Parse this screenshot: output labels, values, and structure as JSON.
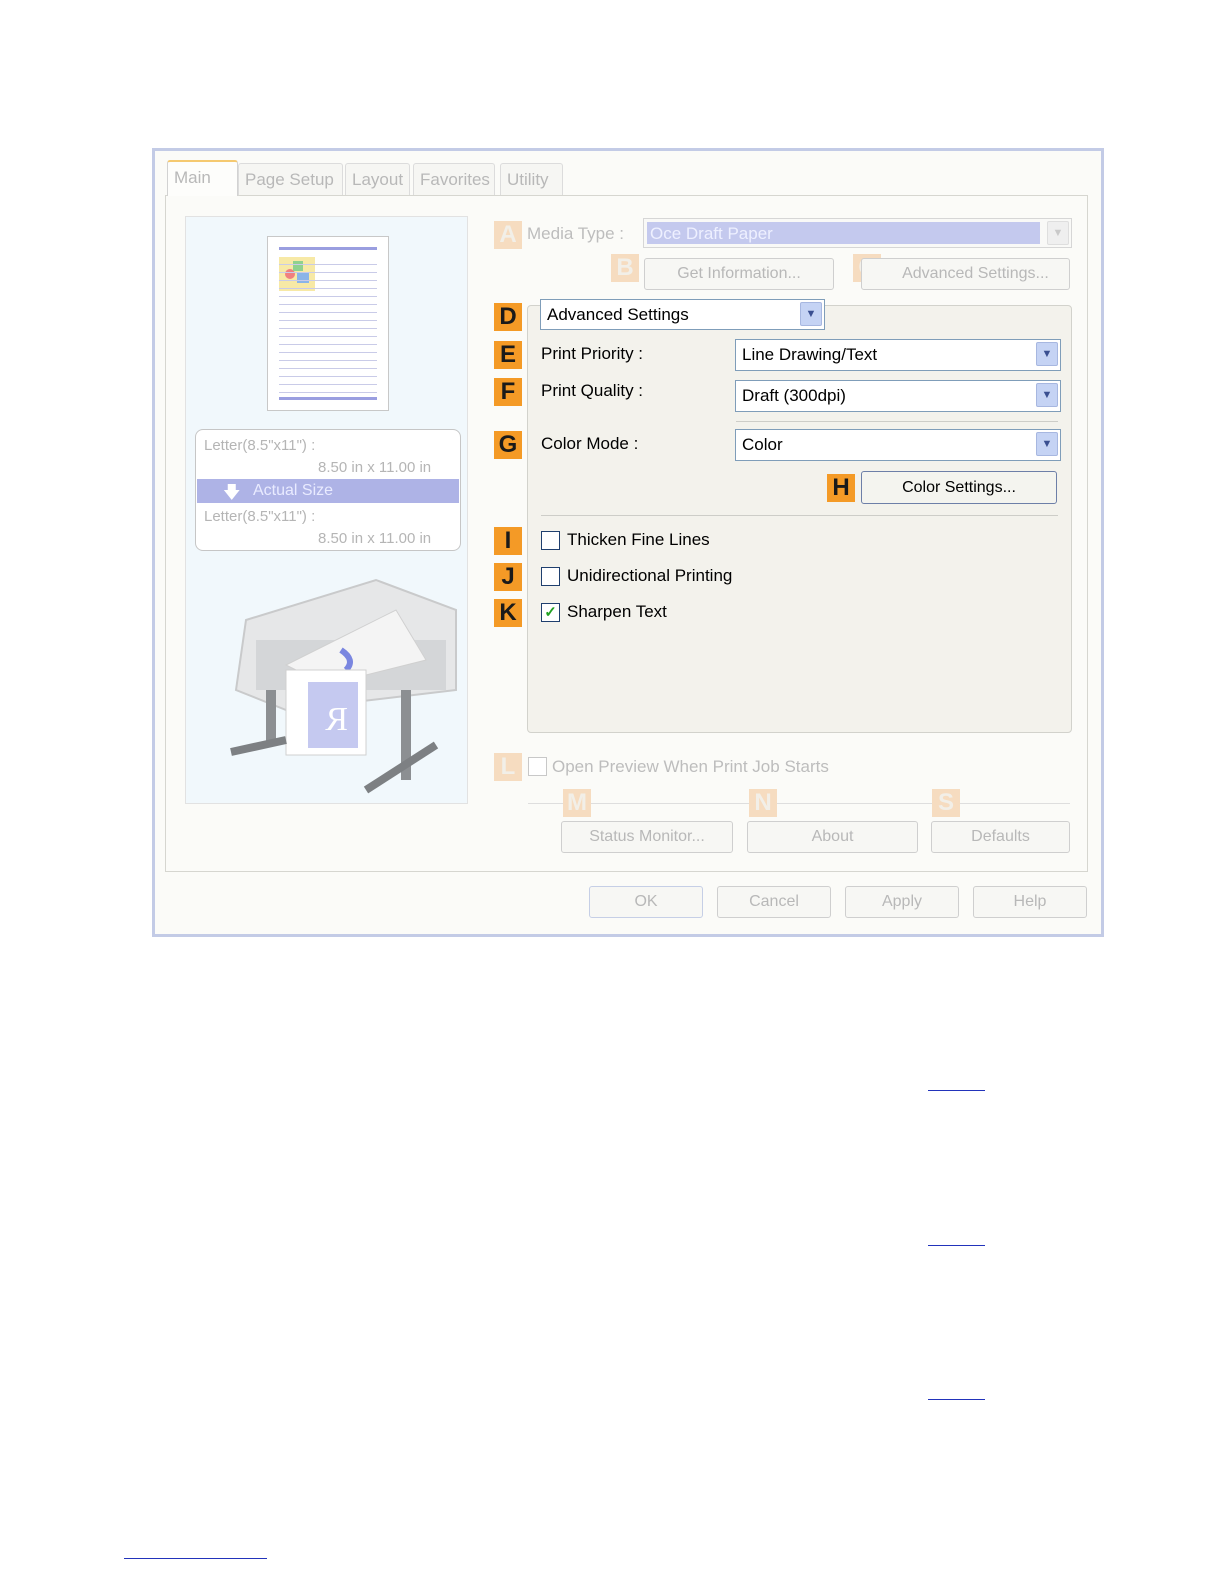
{
  "tabs": [
    "Main",
    "Page Setup",
    "Layout",
    "Favorites",
    "Utility"
  ],
  "preview": {
    "input_size": "Letter(8.5\"x11\") :",
    "input_dims": "8.50 in x 11.00 in",
    "scaling": "Actual Size",
    "output_size": "Letter(8.5\"x11\") :",
    "output_dims": "8.50 in x 11.00 in"
  },
  "badges": {
    "A": "A",
    "B": "B",
    "C": "C",
    "D": "D",
    "E": "E",
    "F": "F",
    "G": "G",
    "H": "H",
    "I": "I",
    "J": "J",
    "K": "K",
    "L": "L",
    "M": "M",
    "N": "N",
    "S": "S"
  },
  "media_type": {
    "label": "Media Type :",
    "value": "Oce Draft Paper"
  },
  "buttons": {
    "get_information": "Get Information...",
    "advanced_settings": "Advanced Settings...",
    "color_settings": "Color Settings...",
    "status_monitor": "Status Monitor...",
    "about": "About",
    "defaults": "Defaults",
    "ok": "OK",
    "cancel": "Cancel",
    "apply": "Apply",
    "help": "Help"
  },
  "mode_select": "Advanced Settings",
  "print_priority": {
    "label": "Print Priority :",
    "value": "Line Drawing/Text"
  },
  "print_quality": {
    "label": "Print Quality :",
    "value": "Draft (300dpi)"
  },
  "color_mode": {
    "label": "Color Mode :",
    "value": "Color"
  },
  "options": {
    "thicken_fine_lines": {
      "label": "Thicken Fine Lines",
      "checked": false
    },
    "unidirectional_printing": {
      "label": "Unidirectional Printing",
      "checked": false
    },
    "sharpen_text": {
      "label": "Sharpen Text",
      "checked": true
    },
    "open_preview": {
      "label": "Open Preview When Print Job Starts",
      "checked": false
    }
  },
  "colors": {
    "badge": "#f49a26",
    "selection": "#aeb3e6",
    "link": "#2233bb"
  }
}
